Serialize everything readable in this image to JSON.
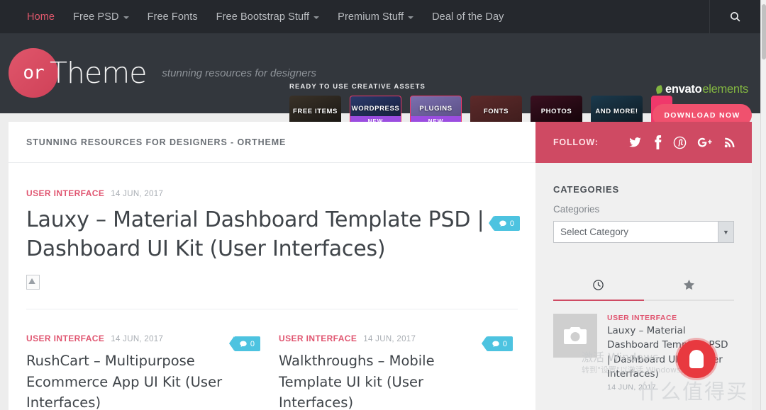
{
  "nav": {
    "items": [
      {
        "label": "Home",
        "active": true,
        "caret": false
      },
      {
        "label": "Free PSD",
        "active": false,
        "caret": true
      },
      {
        "label": "Free Fonts",
        "active": false,
        "caret": false
      },
      {
        "label": "Free Bootstrap Stuff",
        "active": false,
        "caret": true
      },
      {
        "label": "Premium Stuff",
        "active": false,
        "caret": true
      },
      {
        "label": "Deal of the Day",
        "active": false,
        "caret": false
      }
    ],
    "search_icon": "search-icon",
    "active_color": "#e0586c",
    "bg": "#25282d"
  },
  "header": {
    "logo_mark": "or",
    "logo_text": "Theme",
    "tagline": "stunning resources for designers",
    "bg": "#33373d",
    "accent": "#cf4158"
  },
  "ad": {
    "title": "READY TO USE CREATIVE ASSETS",
    "tiles": [
      {
        "label": "FREE ITEMS",
        "badge": ""
      },
      {
        "label": "WORDPRESS",
        "badge": "NEW"
      },
      {
        "label": "PLUGINS",
        "badge": "NEW"
      },
      {
        "label": "FONTS",
        "badge": ""
      },
      {
        "label": "PHOTOS",
        "badge": ""
      },
      {
        "label": "AND MORE!",
        "badge": ""
      }
    ],
    "brand_dark": "envato",
    "brand_green": "elements",
    "cta": "DOWNLOAD NOW",
    "cta_color": "#f0516e"
  },
  "card": {
    "title": "STUNNING RESOURCES FOR DESIGNERS - ORTHEME"
  },
  "featured_post": {
    "category": "USER INTERFACE",
    "date": "14 JUN, 2017",
    "title": "Lauxy – Material Dashboard Template PSD | Dashboard UI Kit (User Interfaces)",
    "comments": "0",
    "broken_image_icon": "broken-image-icon"
  },
  "posts": [
    {
      "category": "USER INTERFACE",
      "date": "14 JUN, 2017",
      "title": "RushCart – Multipurpose Ecommerce App UI Kit (User Interfaces)",
      "comments": "0"
    },
    {
      "category": "USER INTERFACE",
      "date": "14 JUN, 2017",
      "title": "Walkthroughs – Mobile Template UI kit (User Interfaces)",
      "comments": "0"
    }
  ],
  "sidebar": {
    "follow_label": "FOLLOW:",
    "follow_bg": "#cf4a63",
    "social": [
      "twitter-icon",
      "facebook-icon",
      "pinterest-icon",
      "googleplus-icon",
      "rss-icon"
    ],
    "categories_heading": "CATEGORIES",
    "categories_sublabel": "Categories",
    "category_selected": "Select Category",
    "tabs": [
      {
        "icon": "clock-icon",
        "active": true
      },
      {
        "icon": "star-icon",
        "active": false
      }
    ],
    "tab_active_color": "#cf4a63",
    "recent_posts": [
      {
        "category": "USER INTERFACE",
        "title": "Lauxy – Material Dashboard Template PSD | Dashboard UI Kit (User Interfaces)",
        "date": "14 JUN, 2017",
        "thumb_icon": "camera-placeholder-icon"
      }
    ]
  },
  "watermarks": {
    "windows_line1": "激活 Windows",
    "windows_line2": "转到\"设置\"以激活 Windows。",
    "brand_cn": "什么值得买",
    "brand_mark": "值"
  }
}
